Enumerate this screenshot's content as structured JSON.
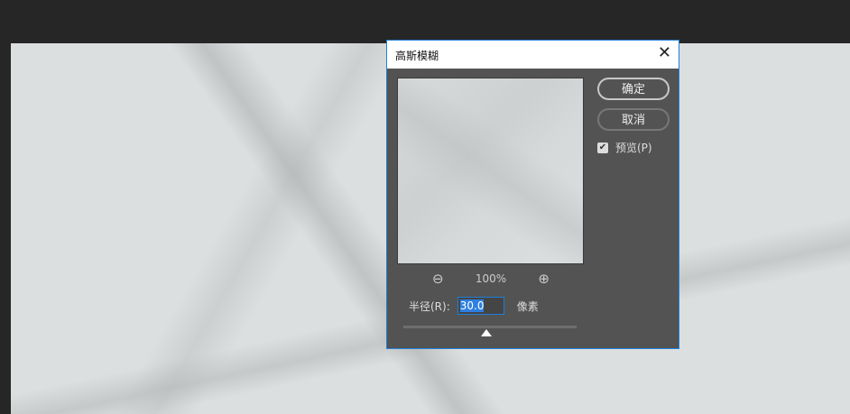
{
  "dialog": {
    "title": "高斯模糊",
    "ok_label": "确定",
    "cancel_label": "取消",
    "preview_label": "预览(P)",
    "preview_checked": true,
    "zoom_level": "100%",
    "radius_label": "半径(R):",
    "radius_value": "30.0",
    "radius_unit": "像素",
    "slider_fraction": 0.48
  },
  "colors": {
    "accent": "#1e7fd8",
    "dialog_bg": "#535353"
  }
}
